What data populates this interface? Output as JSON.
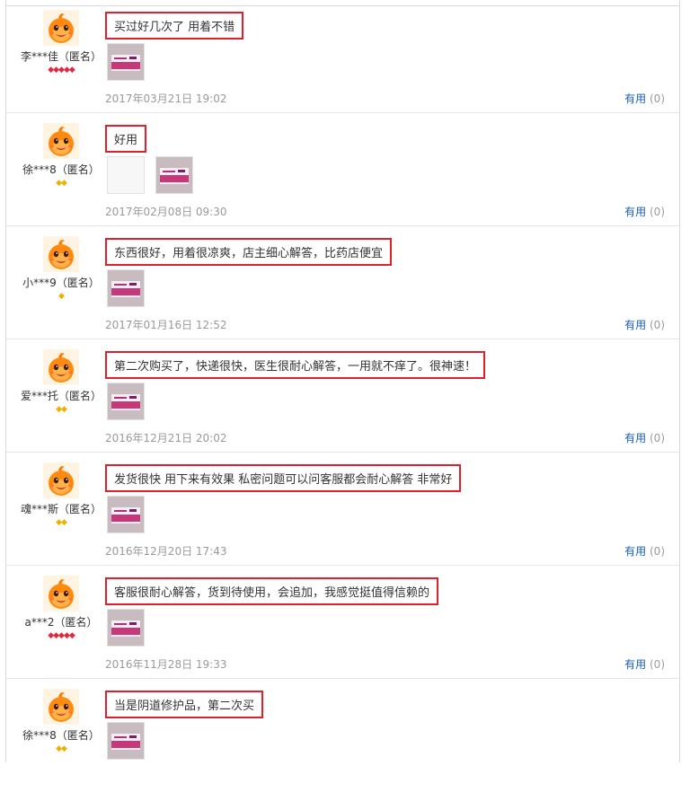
{
  "reviews": [
    {
      "user": "李***佳（匿名）",
      "rank": "diamond",
      "rank_count": 5,
      "comment": "买过好几次了 用着不错",
      "thumbs": [
        "product-photo"
      ],
      "date": "2017年03月21日 19:02",
      "useful_label": "有用",
      "useful_count": "(0)"
    },
    {
      "user": "徐***8（匿名）",
      "rank": "gold",
      "rank_count": 2,
      "comment": "好用",
      "thumbs": [
        "blank-photo",
        "product-photo"
      ],
      "date": "2017年02月08日 09:30",
      "useful_label": "有用",
      "useful_count": "(0)"
    },
    {
      "user": "小***9（匿名）",
      "rank": "gold",
      "rank_count": 1,
      "comment": "东西很好，用着很凉爽，店主细心解答，比药店便宜",
      "thumbs": [
        "product-photo"
      ],
      "date": "2017年01月16日 12:52",
      "useful_label": "有用",
      "useful_count": "(0)"
    },
    {
      "user": "爱***托（匿名）",
      "rank": "gold",
      "rank_count": 2,
      "comment": "第二次购买了，快递很快，医生很耐心解答，一用就不痒了。很神速！",
      "thumbs": [
        "product-photo"
      ],
      "date": "2016年12月21日 20:02",
      "useful_label": "有用",
      "useful_count": "(0)"
    },
    {
      "user": "魂***斯（匿名）",
      "rank": "gold",
      "rank_count": 2,
      "comment": "发货很快 用下来有效果 私密问题可以问客服都会耐心解答 非常好",
      "thumbs": [
        "product-photo"
      ],
      "date": "2016年12月20日 17:43",
      "useful_label": "有用",
      "useful_count": "(0)"
    },
    {
      "user": "a***2（匿名）",
      "rank": "diamond",
      "rank_count": 5,
      "comment": "客服很耐心解答，货到待使用，会追加，我感觉挺值得信赖的",
      "thumbs": [
        "product-photo"
      ],
      "date": "2016年11月28日 19:33",
      "useful_label": "有用",
      "useful_count": "(0)"
    },
    {
      "user": "徐***8（匿名）",
      "rank": "gold",
      "rank_count": 2,
      "comment": "当是阴道修护品，第二次买",
      "thumbs": [
        "product-photo"
      ],
      "date": "",
      "useful_label": "",
      "useful_count": ""
    }
  ],
  "colors": {
    "highlight_box": "#e0202a",
    "link_blue": "#1a5fae",
    "meta_gray": "#9a9a9a",
    "diamond_red": "#e0283f",
    "gold": "#f0b000"
  }
}
